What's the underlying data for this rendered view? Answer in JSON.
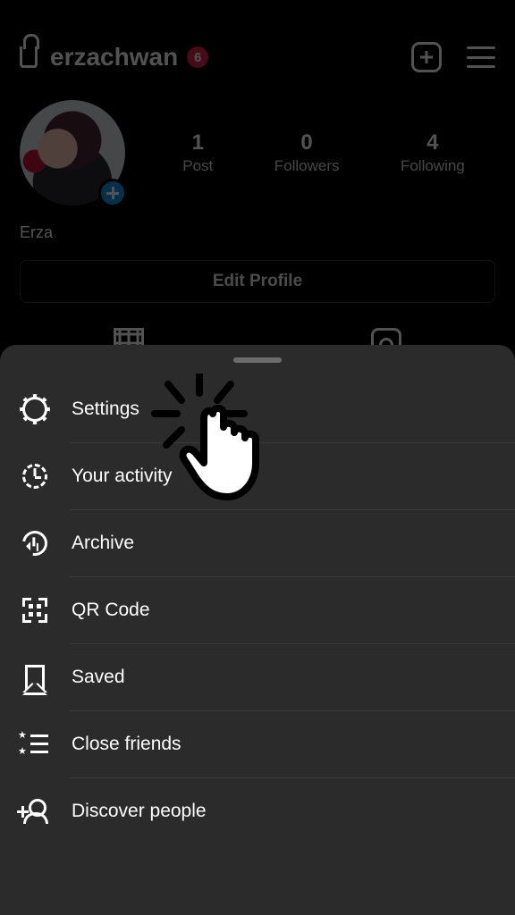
{
  "header": {
    "username": "erzachwan",
    "notification_count": "6"
  },
  "profile": {
    "display_name": "Erza",
    "stats": {
      "posts": {
        "count": "1",
        "label": "Post"
      },
      "followers": {
        "count": "0",
        "label": "Followers"
      },
      "following": {
        "count": "4",
        "label": "Following"
      }
    },
    "edit_button": "Edit Profile"
  },
  "menu": {
    "items": [
      {
        "label": "Settings"
      },
      {
        "label": "Your activity"
      },
      {
        "label": "Archive"
      },
      {
        "label": "QR Code"
      },
      {
        "label": "Saved"
      },
      {
        "label": "Close friends"
      },
      {
        "label": "Discover people"
      }
    ]
  }
}
